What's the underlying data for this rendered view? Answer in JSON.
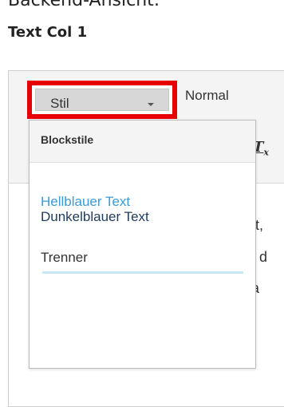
{
  "caption": "Backend-Ansicht:",
  "field_title": "Text Col 1",
  "toolbar": {
    "style_combo_label": "Stil",
    "format_combo_label": "Normal",
    "remove_format_icon": "remove-format-icon"
  },
  "dropdown": {
    "header": "Blockstile",
    "items": [
      {
        "label": "Hellblauer Text",
        "color": "#3a9bd8"
      },
      {
        "label": "Dunkelblauer Text",
        "color": "#1f3b5c"
      },
      {
        "label": "Trenner",
        "color": "#333333"
      }
    ],
    "separator_color": "#c7e6f6"
  },
  "content_fragments": [
    "net,",
    "ed d",
    "ata"
  ],
  "highlight_color": "#e60000"
}
